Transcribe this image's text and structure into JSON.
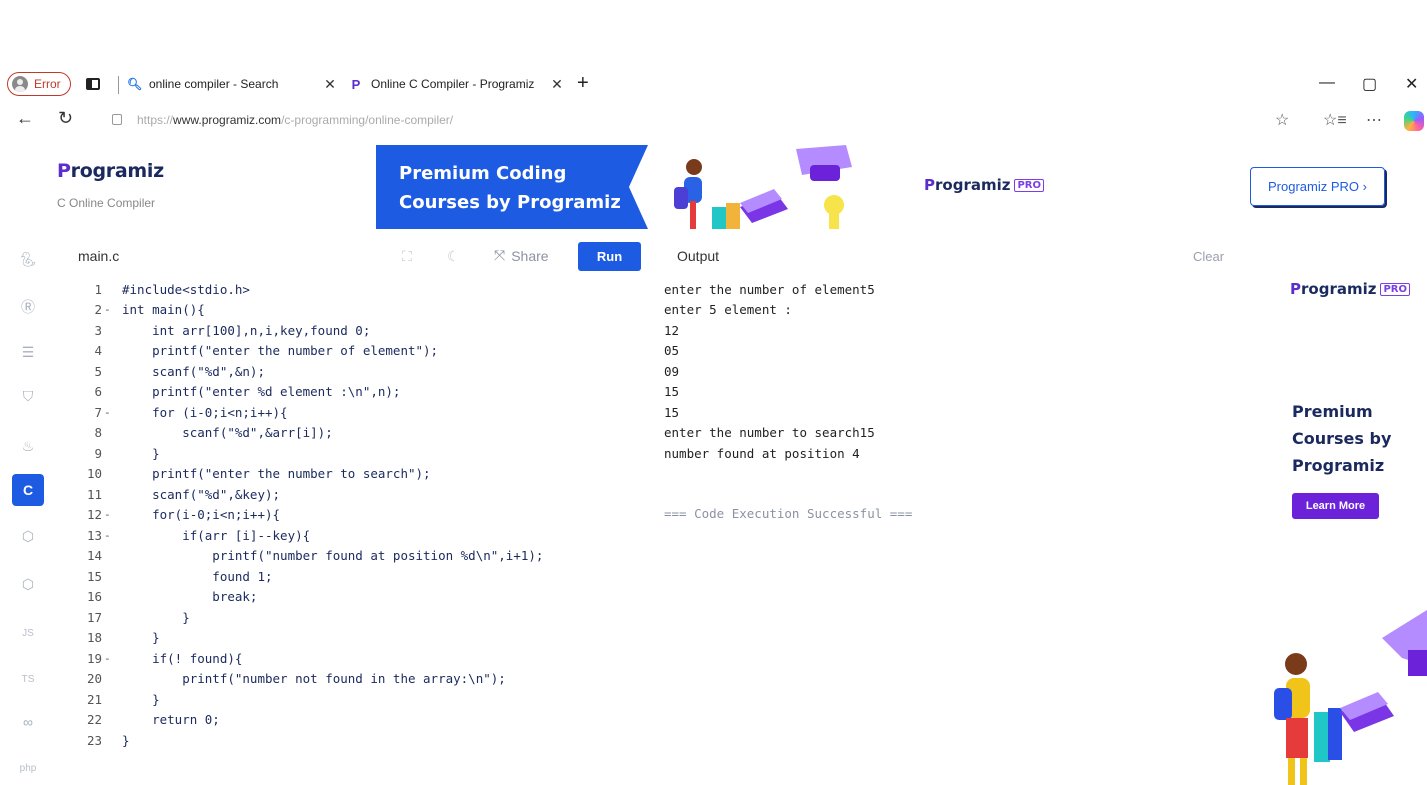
{
  "browser": {
    "profile_label": "Error",
    "tabs": [
      {
        "title": "online compiler - Search",
        "icon": "search-icon"
      },
      {
        "title": "Online C Compiler - Programiz",
        "icon": "programiz-icon"
      }
    ],
    "new_tab": "+",
    "url_prefix": "https://",
    "url_host": "www.programiz.com",
    "url_path": "/c-programming/online-compiler/"
  },
  "header": {
    "logo": "rogramiz",
    "logo_mark": "P",
    "subtitle": "C Online Compiler",
    "banner_line1": "Premium Coding",
    "banner_line2": "Courses by Programiz",
    "banner_logo": "rogramiz",
    "pro_badge": "PRO",
    "pro_button": "Programiz PRO ›"
  },
  "rail": {
    "items": [
      "python-icon",
      "r-icon",
      "sql-icon",
      "html-icon",
      "java-icon",
      "c-icon",
      "cpp-icon",
      "csharp-icon",
      "JS",
      "TS",
      "go-icon",
      "php"
    ]
  },
  "editor": {
    "file_name": "main.c",
    "share_label": "Share",
    "run_label": "Run",
    "lines": [
      {
        "n": "1",
        "fold": "",
        "code": "#include<stdio.h>"
      },
      {
        "n": "2",
        "fold": "-",
        "code": "int main(){"
      },
      {
        "n": "3",
        "fold": "",
        "code": "    int arr[100],n,i,key,found 0;"
      },
      {
        "n": "4",
        "fold": "",
        "code": "    printf(\"enter the number of element\");"
      },
      {
        "n": "5",
        "fold": "",
        "code": "    scanf(\"%d\",&n);"
      },
      {
        "n": "6",
        "fold": "",
        "code": "    printf(\"enter %d element :\\n\",n);"
      },
      {
        "n": "7",
        "fold": "-",
        "code": "    for (i-0;i<n;i++){"
      },
      {
        "n": "8",
        "fold": "",
        "code": "        scanf(\"%d\",&arr[i]);"
      },
      {
        "n": "9",
        "fold": "",
        "code": "    }"
      },
      {
        "n": "10",
        "fold": "",
        "code": "    printf(\"enter the number to search\");"
      },
      {
        "n": "11",
        "fold": "",
        "code": "    scanf(\"%d\",&key);"
      },
      {
        "n": "12",
        "fold": "-",
        "code": "    for(i-0;i<n;i++){"
      },
      {
        "n": "13",
        "fold": "-",
        "code": "        if(arr [i]--key){"
      },
      {
        "n": "14",
        "fold": "",
        "code": "            printf(\"number found at position %d\\n\",i+1);"
      },
      {
        "n": "15",
        "fold": "",
        "code": "            found 1;"
      },
      {
        "n": "16",
        "fold": "",
        "code": "            break;"
      },
      {
        "n": "17",
        "fold": "",
        "code": "        }"
      },
      {
        "n": "18",
        "fold": "",
        "code": "    }"
      },
      {
        "n": "19",
        "fold": "-",
        "code": "    if(! found){"
      },
      {
        "n": "20",
        "fold": "",
        "code": "        printf(\"number not found in the array:\\n\");"
      },
      {
        "n": "21",
        "fold": "",
        "code": "    }"
      },
      {
        "n": "22",
        "fold": "",
        "code": "    return 0;"
      },
      {
        "n": "23",
        "fold": "",
        "code": "}"
      }
    ]
  },
  "output": {
    "label": "Output",
    "clear_label": "Clear",
    "lines": [
      "enter the number of element5",
      "enter 5 element :",
      "12",
      "05",
      "09",
      "15",
      "15",
      "enter the number to search15",
      "number found at position 4"
    ],
    "status": "=== Code Execution Successful ==="
  },
  "side_ad": {
    "logo": "rogramiz",
    "logo_mark": "P",
    "badge": "PRO",
    "headline_line1": "Premium",
    "headline_line2": "Courses by",
    "headline_line3": "Programiz",
    "button": "Learn More"
  },
  "colors": {
    "accent": "#1d5be3",
    "navy": "#1b2a5e",
    "purple": "#6b22d8"
  }
}
